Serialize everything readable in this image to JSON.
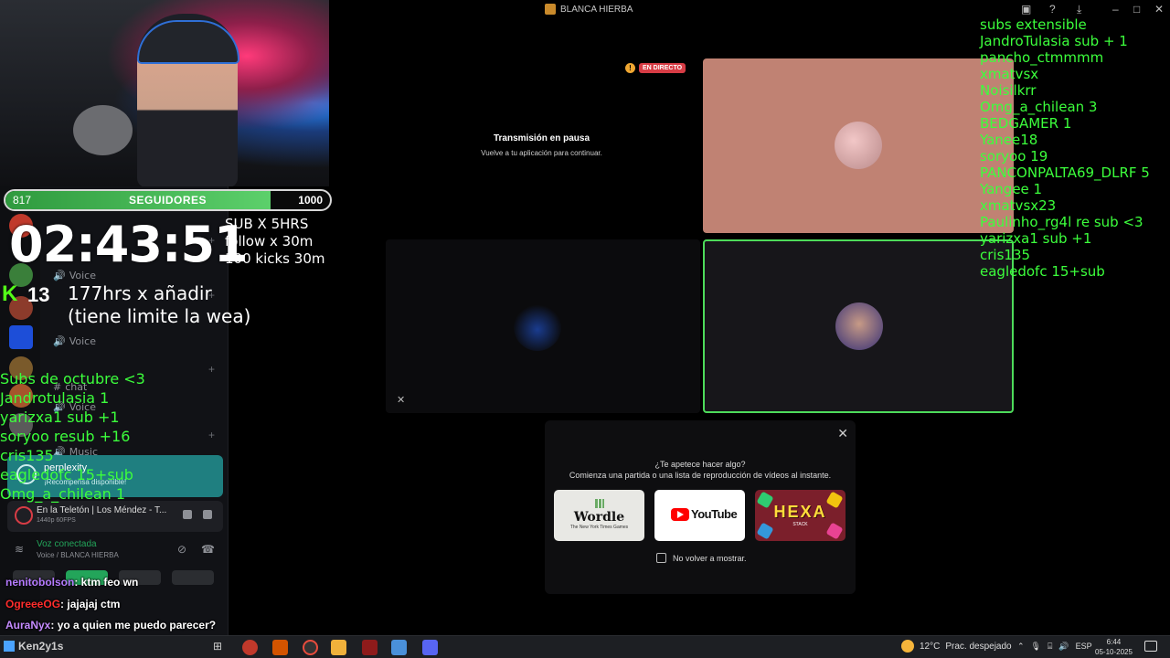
{
  "window": {
    "title": "BLANCA HIERBA"
  },
  "goal": {
    "current": "817",
    "label": "SEGUIDORES",
    "target": "1000",
    "progress_fraction": 0.817
  },
  "overlay": {
    "timer": "02:43:51",
    "rules": [
      "SUB X 5HRS",
      "follow x 30m",
      "100 kicks 30m"
    ],
    "kick_count": "13",
    "hours_line_1": "177hrs x añadir",
    "hours_line_2": "(tiene limite la wea)"
  },
  "left_sub_list": [
    "Subs de octubre <3",
    "Jandrotulasia 1",
    "yarizxa1 sub +1",
    "soryoo resub +16",
    "cris135",
    "eagledofc 15+sub",
    "Omg_a_chilean 1"
  ],
  "sidebar": {
    "channels": [
      {
        "label": "Voice",
        "type": "voice"
      },
      {
        "label": "Voice",
        "type": "voice"
      },
      {
        "label": "Voice",
        "type": "voice"
      },
      {
        "label": "chat",
        "type": "text"
      },
      {
        "label": "Voice",
        "type": "voice"
      },
      {
        "label": "Music",
        "type": "voice"
      }
    ],
    "perplexity": {
      "title": "perplexity",
      "subtitle": "¡Recompensa disponible!"
    },
    "activity": {
      "title": "En la Teletón | Los Méndez - T...",
      "subtitle": "1440p 60FPS"
    },
    "voice": {
      "title": "Voz conectada",
      "subtitle": "Voice / BLANCA HIERBA"
    }
  },
  "chat": [
    {
      "user": "nenitobolson",
      "message": ": ktm feo wn",
      "color": "#b57bff"
    },
    {
      "user": "OgreeeOG",
      "message": ": jajajaj ctm",
      "color": "#ff2d2d"
    },
    {
      "user": "AuraNyx",
      "message": ": yo a quien me puedo parecer?",
      "color": "#c58bff"
    }
  ],
  "call": {
    "paused_title": "Transmisión en pausa",
    "paused_subtitle": "Vuelve a tu aplicación para continuar.",
    "live_label": "EN DIRECTO"
  },
  "activities": {
    "question": "¿Te apetece hacer algo?",
    "subtitle": "Comienza una partida o una lista de reproducción de vídeos al instante.",
    "cards": [
      {
        "name": "Wordle",
        "publisher": "The New York Times Games"
      },
      {
        "name": "YouTube"
      },
      {
        "name": "HEXA",
        "sub": "STACK"
      }
    ],
    "dont_show": "No volver a mostrar."
  },
  "right_list": [
    "subs extensible",
    "JandroTulasia sub + 1",
    "pancho_ctmmmm",
    "xmatvsx",
    "Noisilkrr",
    "Omg_a_chilean 3",
    "BEDGAMER 1",
    "Yanee18",
    "soryoo 19",
    "PANCONPALTA69_DLRF 5",
    "Yangee 1",
    "xmatvsx23",
    "Paulinho_rg4l re sub <3",
    "yarizxa1 sub +1",
    "cris135",
    "eagledofc 15+sub"
  ],
  "taskbar": {
    "user": "Ken2y1s",
    "temperature": "12°C",
    "weather": "Prac. despejado",
    "language": "ESP",
    "time": "6:44",
    "date": "05-10-2025"
  },
  "colors": {
    "accent_green": "#3cff3c",
    "goal_fill": "#3fb24e",
    "live_red": "#d73c45",
    "speaking_border": "#4ddb5a"
  }
}
